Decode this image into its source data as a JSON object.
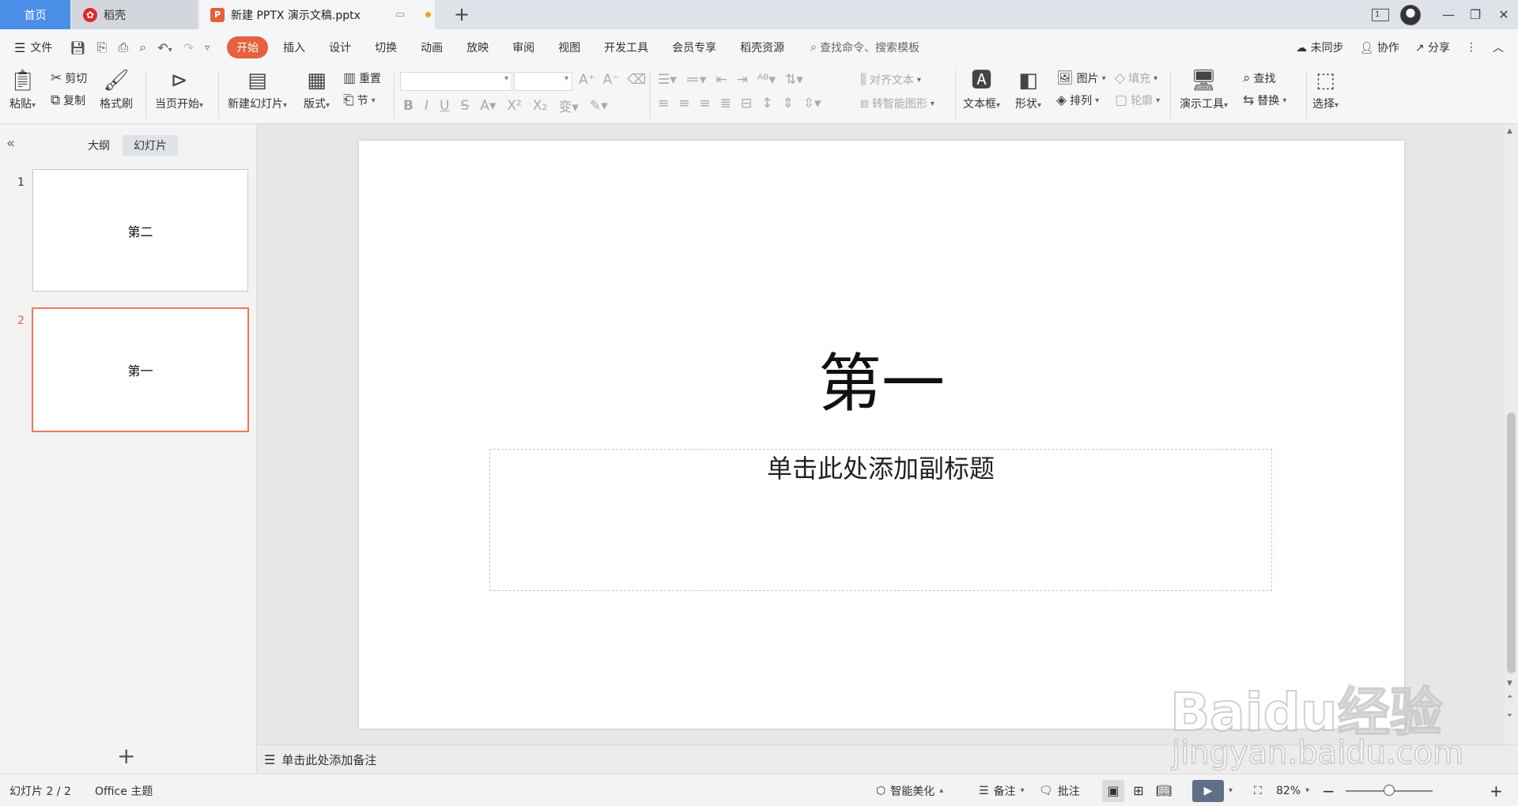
{
  "tabs": {
    "home": "首页",
    "docer": "稻壳",
    "document": "新建 PPTX 演示文稿.pptx"
  },
  "window": {
    "badge": "1"
  },
  "menu": {
    "file": "文件",
    "items": [
      "开始",
      "插入",
      "设计",
      "切换",
      "动画",
      "放映",
      "审阅",
      "视图",
      "开发工具",
      "会员专享",
      "稻壳资源"
    ],
    "search": "查找命令、搜索模板",
    "sync": "未同步",
    "collab": "协作",
    "share": "分享"
  },
  "ribbon": {
    "paste": "粘贴",
    "cut": "剪切",
    "copy": "复制",
    "format_painter": "格式刷",
    "from_current": "当页开始",
    "new_slide": "新建幻灯片",
    "layout": "版式",
    "reset": "重置",
    "section": "节",
    "align_text": "对齐文本",
    "smartart": "转智能图形",
    "textbox": "文本框",
    "shape": "形状",
    "picture": "图片",
    "arrange": "排列",
    "fill": "填充",
    "outline": "轮廓",
    "presenter_tools": "演示工具",
    "find": "查找",
    "replace": "替换",
    "select": "选择"
  },
  "panel": {
    "outline_tab": "大纲",
    "slides_tab": "幻灯片",
    "slides": [
      {
        "number": "1",
        "text": "第二"
      },
      {
        "number": "2",
        "text": "第一"
      }
    ]
  },
  "slide": {
    "title": "第一",
    "subtitle_placeholder": "单击此处添加副标题"
  },
  "notes": {
    "placeholder": "单击此处添加备注"
  },
  "status": {
    "slide_counter": "幻灯片 2 / 2",
    "theme": "Office 主题",
    "beautify": "智能美化",
    "notes": "备注",
    "comments": "批注",
    "zoom": "82%",
    "zoom_fraction": 0.82
  },
  "watermark": {
    "main": "Baidu经验",
    "sub": "jingyan.baidu.com"
  },
  "colors": {
    "accent": "#e6613e",
    "home_tab": "#4a8ee8",
    "selected_border": "#f07858"
  }
}
